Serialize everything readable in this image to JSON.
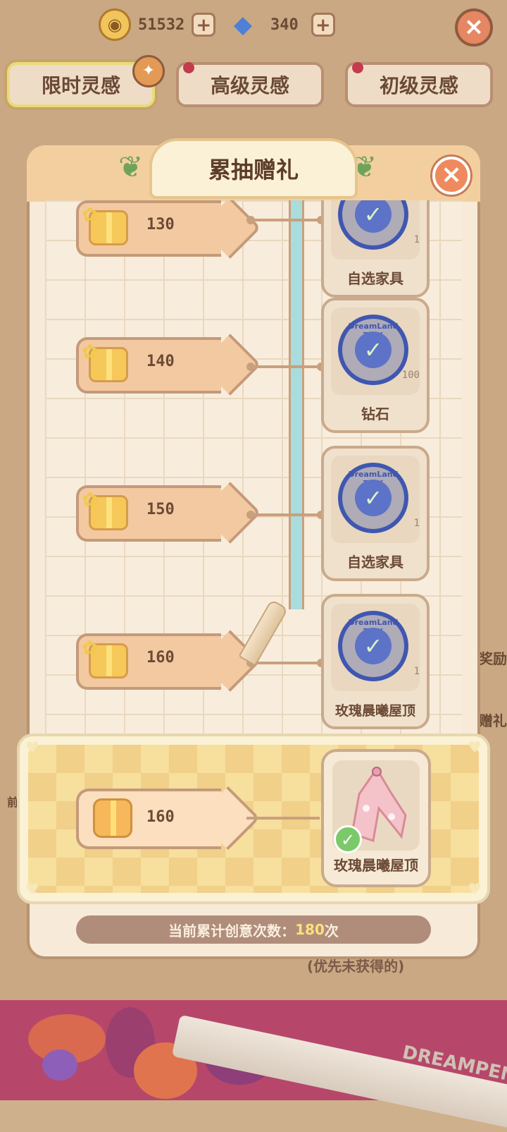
{
  "resources": [
    {
      "icon": "coin-icon",
      "value": "51532"
    },
    {
      "icon": "diamond-icon",
      "value": "340"
    }
  ],
  "tabs": [
    {
      "label": "限时灵感",
      "active": true
    },
    {
      "label": "高级灵感",
      "active": false
    },
    {
      "label": "初级灵感",
      "active": false
    }
  ],
  "panel": {
    "title": "累抽赠礼"
  },
  "milestones": [
    {
      "count": "130",
      "reward": "自选家具",
      "qty": "1",
      "claimed": true
    },
    {
      "count": "140",
      "reward": "钻石",
      "qty": "100",
      "claimed": true
    },
    {
      "count": "150",
      "reward": "自选家具",
      "qty": "1",
      "claimed": true
    },
    {
      "count": "160",
      "reward": "玫瑰晨曦屋顶",
      "qty": "1",
      "claimed": true
    }
  ],
  "stamp_text": "DreamLand TICK",
  "current": {
    "count": "160",
    "reward": "玫瑰晨曦屋顶",
    "claimed": true
  },
  "status": {
    "prefix": "当前累计创意次数：",
    "value": "180",
    "suffix": "次"
  },
  "priority_note": "(优先未获得的)",
  "side_labels": {
    "reward": "奖励",
    "gift": "赠礼",
    "front": "前"
  },
  "footer_brand": "DREAMPEN",
  "colors": {
    "accent": "#ef8a5e",
    "stamp": "#3f57b0",
    "check": "#7cc96a",
    "track": "#a9dcdc"
  }
}
